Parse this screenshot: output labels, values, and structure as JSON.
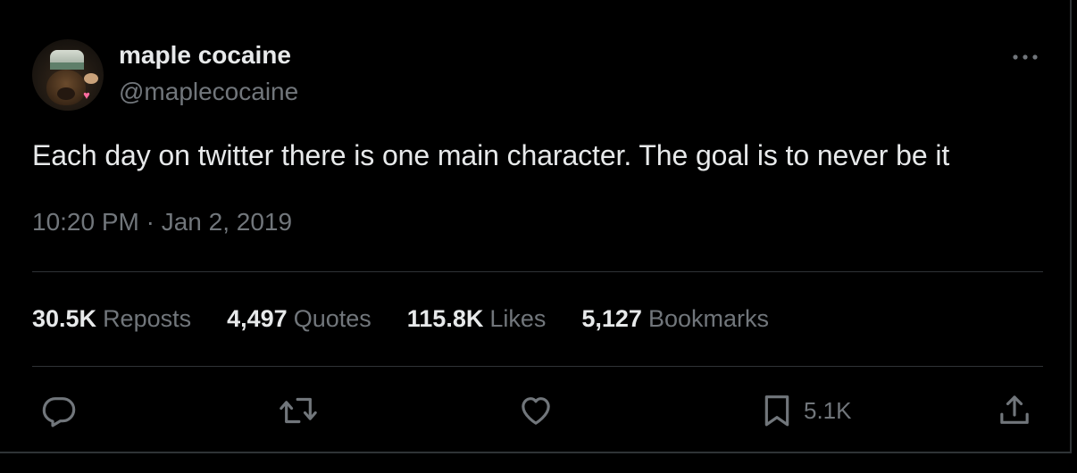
{
  "author": {
    "display_name": "maple cocaine",
    "handle": "@maplecocaine",
    "avatar_badge_icon": "rainbow-heart-icon"
  },
  "tweet": {
    "text": "Each day on twitter there is one main character. The goal is to never be it",
    "timestamp": "10:20 PM · Jan 2, 2019"
  },
  "stats": [
    {
      "value": "30.5K",
      "label": "Reposts"
    },
    {
      "value": "4,497",
      "label": "Quotes"
    },
    {
      "value": "115.8K",
      "label": "Likes"
    },
    {
      "value": "5,127",
      "label": "Bookmarks"
    }
  ],
  "actions": {
    "reply_icon": "reply-icon",
    "repost_icon": "repost-icon",
    "like_icon": "heart-icon",
    "bookmark_icon": "bookmark-icon",
    "bookmark_count": "5.1K",
    "share_icon": "share-icon",
    "more_icon": "more-icon"
  },
  "colors": {
    "background": "#000000",
    "primary_text": "#e7e9ea",
    "secondary_text": "#71767b",
    "divider": "#2f3336"
  }
}
